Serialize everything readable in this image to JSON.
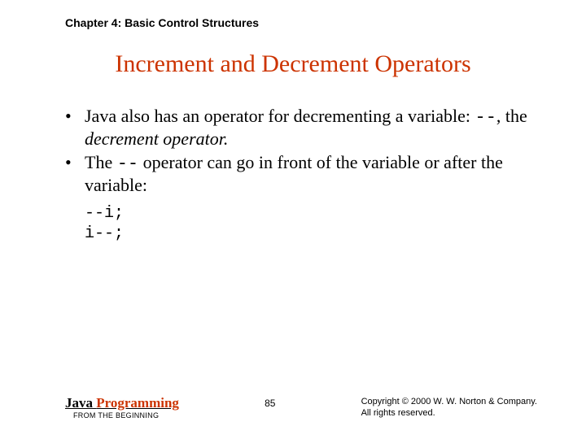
{
  "header": {
    "chapter": "Chapter 4: Basic Control Structures"
  },
  "title": "Increment and Decrement Operators",
  "bullets": [
    {
      "pre": "Java also has an operator for decrementing a variable: ",
      "op": "--",
      "mid": ", the ",
      "term": "decrement operator.",
      "post": ""
    },
    {
      "pre": "The ",
      "op": "--",
      "mid": " operator can go in front of the variable or after the variable:",
      "term": "",
      "post": ""
    }
  ],
  "code": {
    "line1": "--i;",
    "line2": "i--;"
  },
  "footer": {
    "book_java": "Java ",
    "book_prog": "Programming",
    "book_sub": "FROM THE BEGINNING",
    "page": "85",
    "copyright_l1": "Copyright © 2000 W. W. Norton & Company.",
    "copyright_l2": "All rights reserved."
  }
}
